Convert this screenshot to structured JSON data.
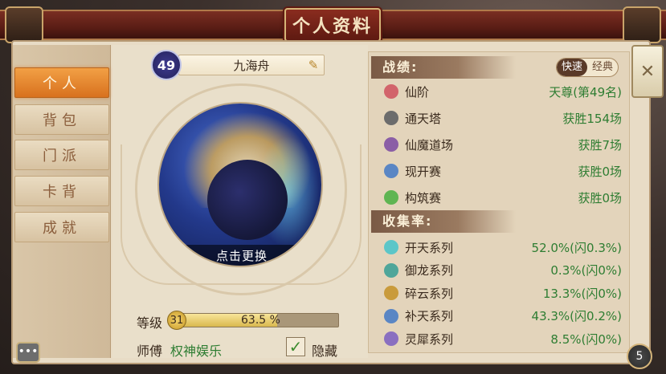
{
  "title": "个人资料",
  "tabs": [
    {
      "label": "个人",
      "active": true
    },
    {
      "label": "背包",
      "active": false
    },
    {
      "label": "门派",
      "active": false
    },
    {
      "label": "卡背",
      "active": false
    },
    {
      "label": "成就",
      "active": false
    }
  ],
  "profile": {
    "level_badge": "49",
    "name": "九海舟",
    "change_avatar": "点击更换",
    "level_label": "等级",
    "level": "31",
    "progress_text": "63.5 %",
    "progress_fraction": 0.635,
    "master_label": "师傅",
    "master_name": "权神娱乐",
    "hide_label": "隐藏",
    "hide_checked": true
  },
  "record": {
    "header": "战绩:",
    "mode_fast": "快速",
    "mode_classic": "经典",
    "rows": [
      {
        "icon": "star-icon",
        "color": "#d2646b",
        "label": "仙阶",
        "value": "天尊(第49名)"
      },
      {
        "icon": "tower-icon",
        "color": "#6c6c6c",
        "label": "通天塔",
        "value": "获胜154场"
      },
      {
        "icon": "demon-icon",
        "color": "#8b5ea6",
        "label": "仙魔道场",
        "value": "获胜7场"
      },
      {
        "icon": "open-icon",
        "color": "#5a86c4",
        "label": "现开赛",
        "value": "获胜0场"
      },
      {
        "icon": "build-icon",
        "color": "#5fb552",
        "label": "构筑赛",
        "value": "获胜0场"
      }
    ]
  },
  "collection": {
    "header": "收集率:",
    "rows": [
      {
        "icon": "feather-icon",
        "color": "#5cc6c8",
        "label": "开天系列",
        "value": "52.0%(闪0.3%)"
      },
      {
        "icon": "dragon-icon",
        "color": "#4fa69a",
        "label": "御龙系列",
        "value": "0.3%(闪0%)"
      },
      {
        "icon": "cloud-icon",
        "color": "#c99b3c",
        "label": "碎云系列",
        "value": "13.3%(闪0%)"
      },
      {
        "icon": "sky-icon",
        "color": "#5a86c4",
        "label": "补天系列",
        "value": "43.3%(闪0.2%)"
      },
      {
        "icon": "rhino-icon",
        "color": "#8a6fc0",
        "label": "灵犀系列",
        "value": "8.5%(闪0%)"
      }
    ]
  },
  "page_number": "5",
  "close_glyph": "✕",
  "chat_glyph": "•••"
}
